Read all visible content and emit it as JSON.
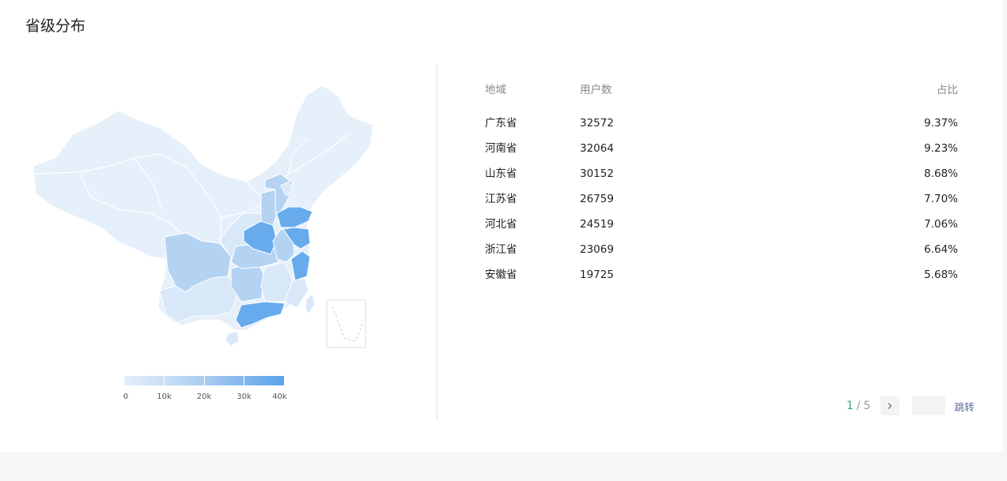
{
  "title": "省级分布",
  "legend": {
    "ticks": [
      "0",
      "10k",
      "20k",
      "30k",
      "40k"
    ],
    "colors": [
      "#e4eef9",
      "#c9dff5",
      "#a9ccf1",
      "#83b7ee",
      "#5aa4ea"
    ]
  },
  "map": {
    "base_color": "#e6f0fa",
    "light_color": "#d8e8f8",
    "mid_color": "#b4d3f3",
    "dark_color": "#67abed",
    "border_color": "#ffffff"
  },
  "table": {
    "headers": {
      "region": "地域",
      "users": "用户数",
      "ratio": "占比"
    },
    "rows": [
      {
        "region": "广东省",
        "users": "32572",
        "ratio": "9.37%"
      },
      {
        "region": "河南省",
        "users": "32064",
        "ratio": "9.23%"
      },
      {
        "region": "山东省",
        "users": "30152",
        "ratio": "8.68%"
      },
      {
        "region": "江苏省",
        "users": "26759",
        "ratio": "7.70%"
      },
      {
        "region": "河北省",
        "users": "24519",
        "ratio": "7.06%"
      },
      {
        "region": "浙江省",
        "users": "23069",
        "ratio": "6.64%"
      },
      {
        "region": "安徽省",
        "users": "19725",
        "ratio": "5.68%"
      }
    ]
  },
  "pagination": {
    "current": "1",
    "separator": "/",
    "total": "5",
    "next_icon": "chevron-right-icon",
    "jump_value": "",
    "jump_label": "跳转"
  }
}
